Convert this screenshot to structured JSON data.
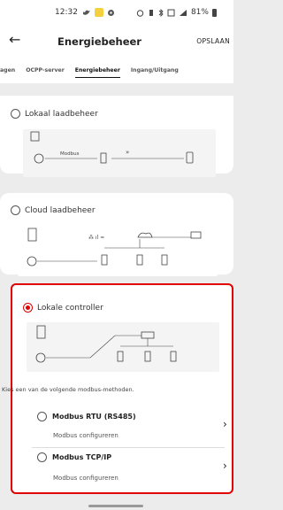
{
  "status": {
    "time": "12:32",
    "battery": "81%"
  },
  "header": {
    "title": "Energiebeheer",
    "save_label": "OPSLAAN"
  },
  "tabs": [
    {
      "label": "agen"
    },
    {
      "label": "OCPP-server"
    },
    {
      "label": "Energiebeheer"
    },
    {
      "label": "Ingang/Uitgang"
    }
  ],
  "options": {
    "local": {
      "label": "Lokaal laadbeheer",
      "diagram_text": "Modbus"
    },
    "cloud": {
      "label": "Cloud laadbeheer"
    },
    "controller": {
      "label": "Lokale controller"
    }
  },
  "modbus": {
    "help": "Kies een van de volgende modbus-methoden.",
    "rtu": {
      "title": "Modbus RTU (RS485)",
      "sub": "Modbus configureren"
    },
    "tcp": {
      "title": "Modbus TCP/IP",
      "sub": "Modbus configureren"
    }
  },
  "colors": {
    "accent": "#e00000"
  }
}
